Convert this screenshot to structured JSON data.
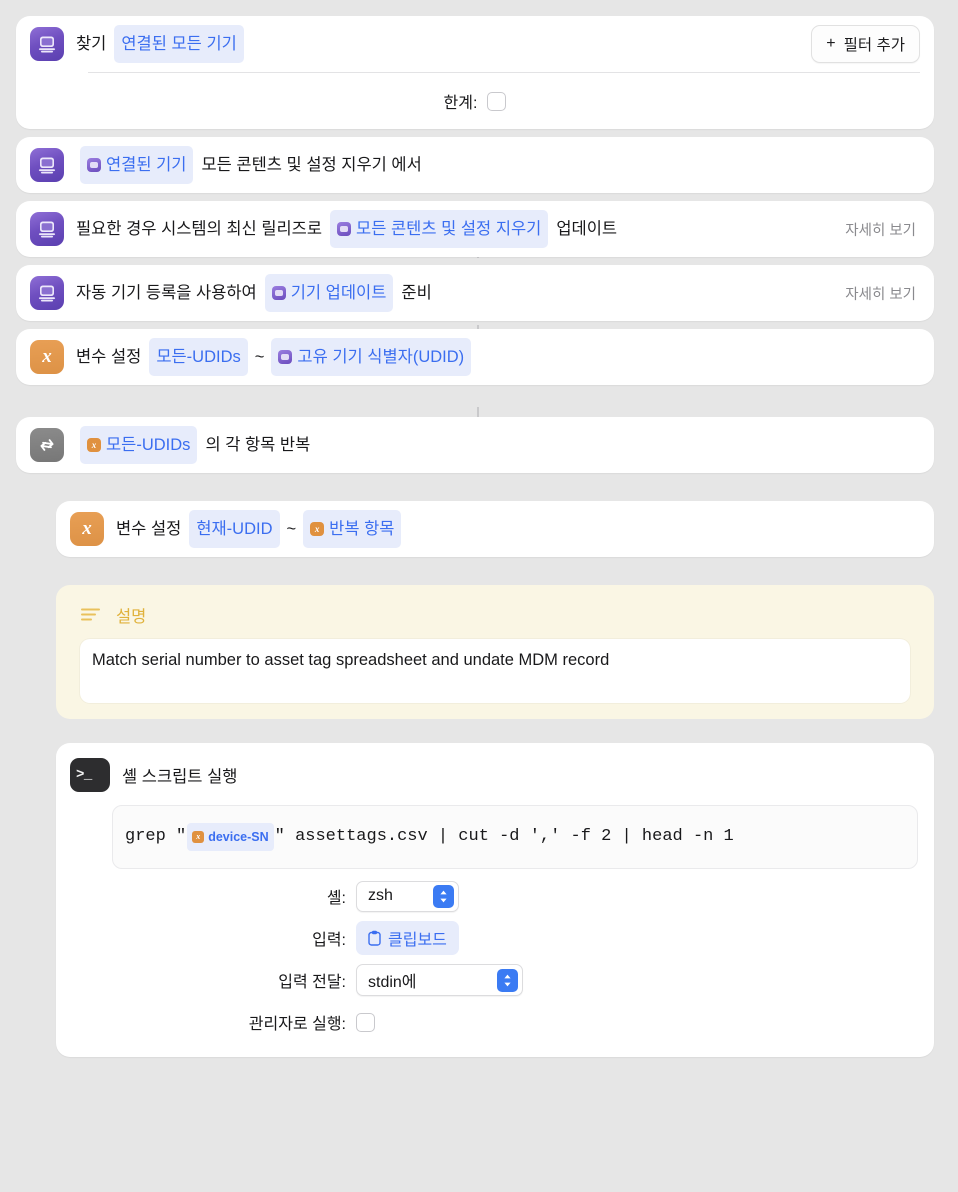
{
  "workflow": {
    "steps": [
      {
        "id": "find-devices",
        "icon": "device-icon",
        "text_before": "찾기",
        "token": "연결된 모든 기기",
        "add_filter_label": "필터 추가",
        "param_label": "한계:",
        "param_checked": false
      },
      {
        "id": "erase-from-device",
        "icon": "device-icon",
        "token": "연결된 기기",
        "text_after": "모든 콘텐츠 및 설정 지우기 에서"
      },
      {
        "id": "update-device",
        "icon": "device-icon",
        "text_before": "필요한 경우 시스템의 최신 릴리즈로",
        "token": "모든 콘텐츠 및 설정 지우기",
        "text_after": "업데이트",
        "show_more": "자세히 보기"
      },
      {
        "id": "prepare-device",
        "icon": "device-icon",
        "text_before": "자동 기기 등록을 사용하여",
        "token": "기기 업데이트",
        "text_after": "준비",
        "show_more": "자세히 보기"
      },
      {
        "id": "set-variable-all-udids",
        "icon": "variable-x-icon",
        "text_before": "변수 설정",
        "token1": "모든-UDIDs",
        "separator": "~",
        "token2": "고유 기기 식별자(UDID)"
      },
      {
        "id": "repeat-each",
        "icon": "repeat-icon",
        "token": "모든-UDIDs",
        "text_after": "의 각 항목 반복"
      },
      {
        "id": "set-variable-current-udid",
        "icon": "variable-x-icon",
        "text_before": "변수 설정",
        "token1": "현재-UDID",
        "separator": "~",
        "token2": "반복 항목"
      }
    ],
    "comment": {
      "id": "comment-block",
      "icon": "text-lines-icon",
      "title": "설명",
      "body": "Match serial number to asset tag spreadsheet and undate MDM record"
    },
    "shell_script": {
      "id": "run-shell-script",
      "icon": "terminal-icon",
      "title": "셸 스크립트 실행",
      "script": {
        "part1": "grep \"",
        "variable": "device-SN",
        "part2": "\" assettags.csv | cut -d ',' -f 2 | head -n 1"
      },
      "params": [
        {
          "label": "셸:",
          "type": "popup",
          "value": "zsh"
        },
        {
          "label": "입력:",
          "type": "chip",
          "value": "클립보드",
          "icon": "clipboard-icon"
        },
        {
          "label": "입력 전달:",
          "type": "popup",
          "value": "stdin에"
        },
        {
          "label": "관리자로 실행:",
          "type": "checkbox",
          "checked": false
        }
      ]
    }
  },
  "colors": {
    "background": "#e6e6e6",
    "card": "#ffffff",
    "token_bg": "#e7ecfb",
    "token_text": "#3b6ef0",
    "device_icon": "#6f4fc0",
    "variable_icon": "#e0913f",
    "repeat_icon": "#8b8b8b",
    "terminal_icon": "#2d2d2f",
    "comment_bg": "#faf6e4",
    "comment_text": "#e0b23c",
    "accent_blue": "#3b7bf3"
  }
}
